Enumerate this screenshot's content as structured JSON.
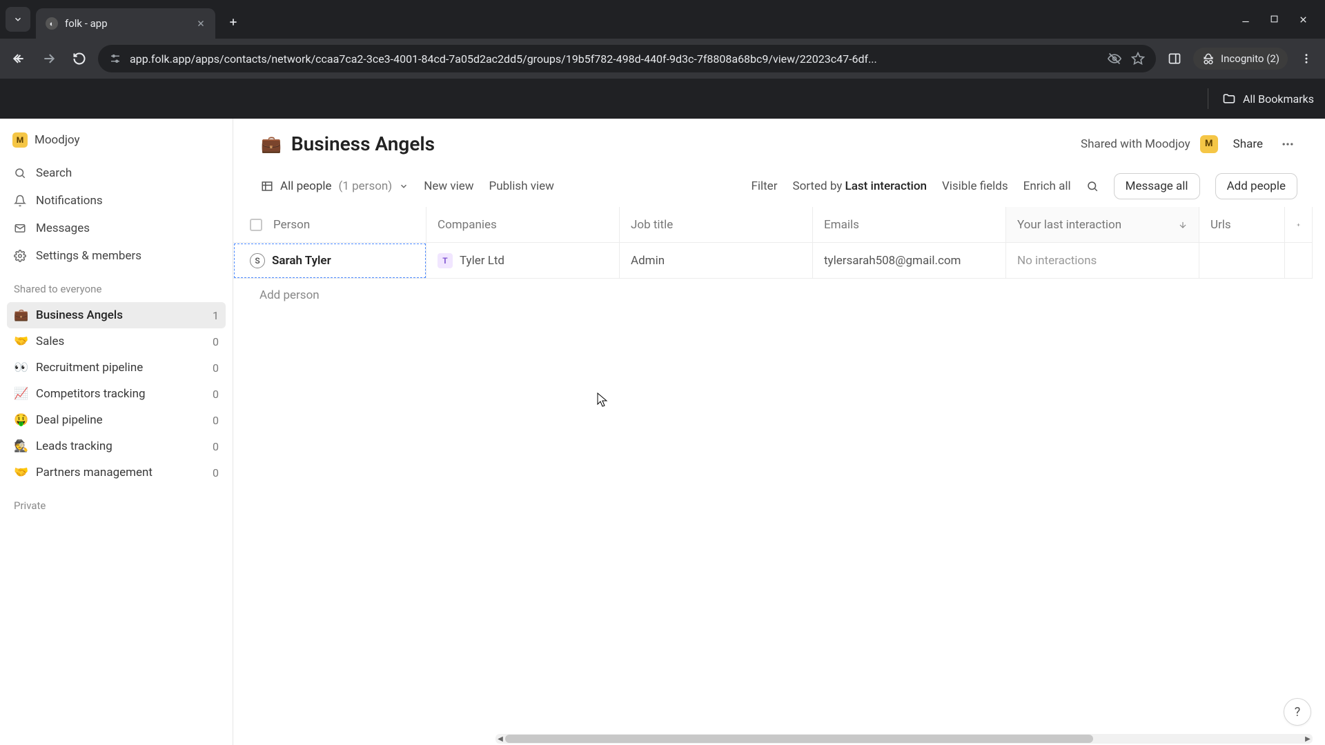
{
  "browser": {
    "tab_title": "folk - app",
    "url": "app.folk.app/apps/contacts/network/ccaa7ca2-3ce3-4001-84cd-7a05d2ac2dd5/groups/19b5f782-498d-440f-9d3c-7f8808a68bc9/view/22023c47-6df...",
    "incognito_label": "Incognito (2)",
    "bookmarks_label": "All Bookmarks"
  },
  "sidebar": {
    "workspace": {
      "avatar_letter": "M",
      "name": "Moodjoy"
    },
    "nav": {
      "search": "Search",
      "notifications": "Notifications",
      "messages": "Messages",
      "settings": "Settings & members"
    },
    "shared_label": "Shared to everyone",
    "private_label": "Private",
    "groups": [
      {
        "emoji": "💼",
        "label": "Business Angels",
        "count": "1",
        "active": true
      },
      {
        "emoji": "🤝",
        "label": "Sales",
        "count": "0"
      },
      {
        "emoji": "👀",
        "label": "Recruitment pipeline",
        "count": "0"
      },
      {
        "emoji": "📈",
        "label": "Competitors tracking",
        "count": "0"
      },
      {
        "emoji": "🤑",
        "label": "Deal pipeline",
        "count": "0"
      },
      {
        "emoji": "🕵️",
        "label": "Leads tracking",
        "count": "0"
      },
      {
        "emoji": "🤝",
        "label": "Partners management",
        "count": "0"
      }
    ]
  },
  "header": {
    "emoji": "💼",
    "title": "Business Angels",
    "shared_with_text": "Shared with Moodjoy",
    "shared_avatar_letter": "M",
    "share_label": "Share"
  },
  "toolbar": {
    "view_name": "All people",
    "view_count": "(1 person)",
    "new_view": "New view",
    "publish_view": "Publish view",
    "filter": "Filter",
    "sorted_by_prefix": "Sorted by",
    "sorted_by_value": "Last interaction",
    "visible_fields": "Visible fields",
    "enrich_all": "Enrich all",
    "message_all": "Message all",
    "add_people": "Add people"
  },
  "table": {
    "columns": {
      "person": "Person",
      "companies": "Companies",
      "job_title": "Job title",
      "emails": "Emails",
      "last_interaction": "Your last interaction",
      "urls": "Urls"
    },
    "rows": [
      {
        "person_initial": "S",
        "person_name": "Sarah Tyler",
        "company_initial": "T",
        "company_name": "Tyler Ltd",
        "job_title": "Admin",
        "email": "tylersarah508@gmail.com",
        "last_interaction": "No interactions",
        "urls": ""
      }
    ],
    "add_person": "Add person"
  },
  "help_label": "?"
}
